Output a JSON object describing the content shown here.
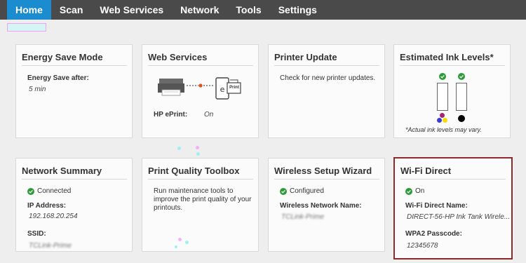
{
  "nav": {
    "items": [
      {
        "label": "Home",
        "active": true
      },
      {
        "label": "Scan",
        "active": false
      },
      {
        "label": "Web Services",
        "active": false
      },
      {
        "label": "Network",
        "active": false
      },
      {
        "label": "Tools",
        "active": false
      },
      {
        "label": "Settings",
        "active": false
      }
    ]
  },
  "cards": {
    "energy": {
      "title": "Energy Save Mode",
      "label": "Energy Save after:",
      "value": "5 min"
    },
    "web_services": {
      "title": "Web Services",
      "eprint_label": "HP ePrint:",
      "eprint_value": "On",
      "print_icon_text": "Print"
    },
    "printer_update": {
      "title": "Printer Update",
      "text": "Check for new printer updates."
    },
    "ink": {
      "title": "Estimated Ink Levels*",
      "note": "*Actual ink levels may vary.",
      "cartridges": [
        {
          "name": "tri-color",
          "status": "ok",
          "colors": [
            "#a0286e",
            "#3b3fcf",
            "#f5d90a"
          ]
        },
        {
          "name": "black",
          "status": "ok",
          "colors": [
            "#000000"
          ]
        }
      ]
    },
    "network": {
      "title": "Network Summary",
      "status": "Connected",
      "ip_label": "IP Address:",
      "ip_value": "192.168.20.254",
      "ssid_label": "SSID:",
      "ssid_value": "TCLink-Prime"
    },
    "print_quality": {
      "title": "Print Quality Toolbox",
      "text": "Run maintenance tools to improve the print quality of your printouts."
    },
    "wireless": {
      "title": "Wireless Setup Wizard",
      "status": "Configured",
      "name_label": "Wireless Network Name:",
      "name_value": "TCLink-Prime"
    },
    "wifi_direct": {
      "title": "Wi-Fi Direct",
      "status": "On",
      "name_label": "Wi-Fi Direct Name:",
      "name_value": "DIRECT-56-HP Ink Tank Wirele...",
      "pass_label": "WPA2 Passcode:",
      "pass_value": "12345678"
    }
  },
  "colors": {
    "nav_bg": "#4a4a4a",
    "nav_active": "#1a8ccf",
    "check_green": "#2e9b3a",
    "highlight_border": "#8b2a2a"
  }
}
